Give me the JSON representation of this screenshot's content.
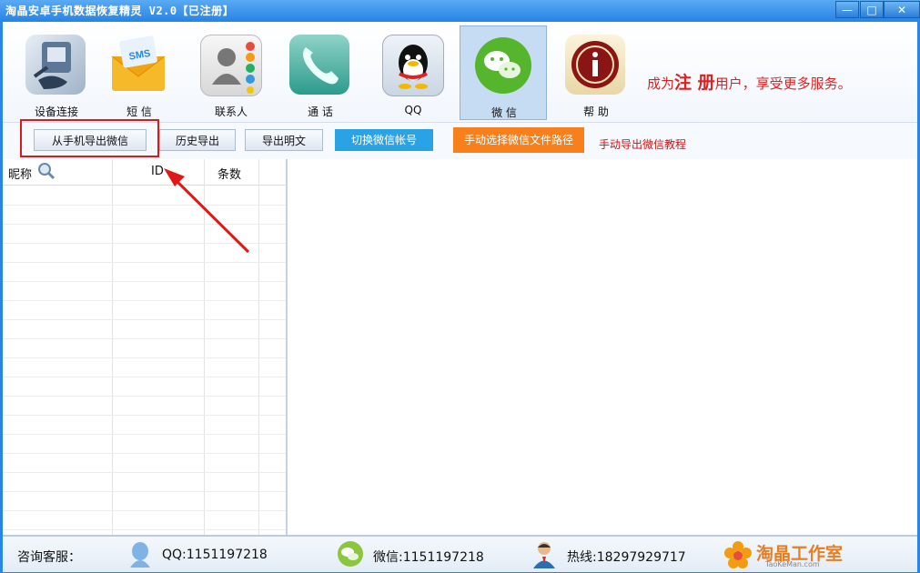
{
  "window": {
    "title": "淘晶安卓手机数据恢复精灵 V2.0【已注册】",
    "minimize": "—",
    "maximize": "□",
    "close": "✕"
  },
  "toolbar": {
    "items": [
      {
        "label": "设备连接",
        "icon": "device-connect-icon"
      },
      {
        "label": "短 信",
        "icon": "sms-envelope-icon"
      },
      {
        "label": "联系人",
        "icon": "contacts-icon"
      },
      {
        "label": "通 话",
        "icon": "phone-call-icon"
      },
      {
        "label": "QQ",
        "icon": "qq-penguin-icon"
      },
      {
        "label": "微 信",
        "icon": "wechat-icon",
        "active": true
      },
      {
        "label": "帮 助",
        "icon": "help-info-icon"
      }
    ],
    "promo_prefix": "成为",
    "promo_big": "注 册",
    "promo_suffix": "用户，享受更多服务。"
  },
  "actions": {
    "export_from_phone": "从手机导出微信",
    "history_export": "历史导出",
    "export_plaintext": "导出明文",
    "switch_account": "切换微信帐号",
    "manual_select_path": "手动选择微信文件路径",
    "manual_tutorial": "手动导出微信教程"
  },
  "table": {
    "columns": [
      "昵称",
      "ID",
      "条数"
    ],
    "rows": []
  },
  "status": {
    "service_label": "咨询客服：",
    "qq": "QQ:1151197218",
    "wechat": "微信:1151197218",
    "hotline": "热线:18297929717",
    "brand": "淘晶工作室",
    "brand_sub": "TaoKeMan.com"
  },
  "colors": {
    "title_bar": "#2a86e6",
    "annotation_red": "#e01818",
    "switch_button": "#2aa3e6",
    "path_button": "#f8801c"
  }
}
